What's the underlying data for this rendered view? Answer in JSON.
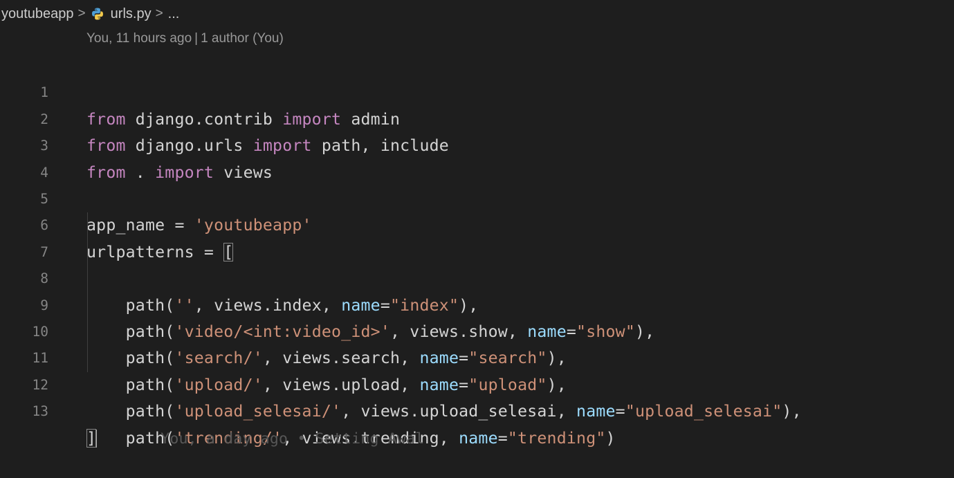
{
  "breadcrumb": {
    "folder": "youtubeapp",
    "file": "urls.py",
    "more": "...",
    "separator": ">"
  },
  "codelens": {
    "last_change": "You, 11 hours ago",
    "separator": "|",
    "authors": "1 author (You)"
  },
  "line_numbers": [
    "1",
    "2",
    "3",
    "4",
    "5",
    "6",
    "7",
    "8",
    "9",
    "10",
    "11",
    "12",
    "13"
  ],
  "code": {
    "l1": [
      "from",
      " django.contrib ",
      "import",
      " admin"
    ],
    "l2": [
      "from",
      " django.urls ",
      "import",
      " path, include"
    ],
    "l3": [
      "from",
      " . ",
      "import",
      " views"
    ],
    "l5": [
      "app_name = ",
      "'youtubeapp'"
    ],
    "l6": [
      "urlpatterns = ",
      "["
    ],
    "routes": [
      {
        "pre": "    path(",
        "route": "''",
        "mid": ", views.index, ",
        "kw": "name",
        "eq": "=",
        "name": "\"index\"",
        "end": "),"
      },
      {
        "pre": "    path(",
        "route": "'video/<int:video_id>'",
        "mid": ", views.show, ",
        "kw": "name",
        "eq": "=",
        "name": "\"show\"",
        "end": "),"
      },
      {
        "pre": "    path(",
        "route": "'search/'",
        "mid": ", views.search, ",
        "kw": "name",
        "eq": "=",
        "name": "\"search\"",
        "end": "),"
      },
      {
        "pre": "    path(",
        "route": "'upload/'",
        "mid": ", views.upload, ",
        "kw": "name",
        "eq": "=",
        "name": "\"upload\"",
        "end": "),"
      },
      {
        "pre": "    path(",
        "route": "'upload_selesai/'",
        "mid": ", views.upload_selesai, ",
        "kw": "name",
        "eq": "=",
        "name": "\"upload_selesai\"",
        "end": "),"
      },
      {
        "pre": "    path(",
        "route": "'trending/'",
        "mid": ", views.trending, ",
        "kw": "name",
        "eq": "=",
        "name": "\"trending\"",
        "end": ")"
      }
    ],
    "l13": "]"
  },
  "blame_inline": "You, a day ago • Setting Awal",
  "colors": {
    "background": "#1e1e1e",
    "keyword": "#c586c0",
    "string": "#ce9178",
    "parameter": "#9cdcfe",
    "text": "#d4d4d4",
    "line_number": "#858585"
  },
  "icons": {
    "file_type": "python-icon"
  }
}
